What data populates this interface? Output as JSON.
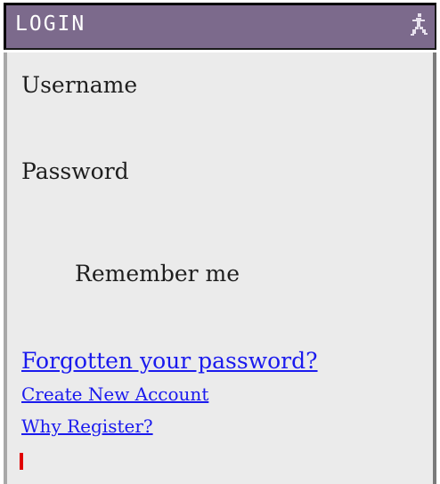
{
  "window": {
    "title": "LOGIN",
    "icon": "runner-icon"
  },
  "form": {
    "username_label": "Username",
    "password_label": "Password",
    "remember_label": "Remember me"
  },
  "links": {
    "forgot_password": "Forgotten your password?",
    "create_account": "Create New Account ",
    "why_register": "Why Register?"
  },
  "colors": {
    "titlebar": "#7c6a8c",
    "content_background": "#ebebeb",
    "link": "#1a1aee",
    "cursor": "#e00000"
  }
}
